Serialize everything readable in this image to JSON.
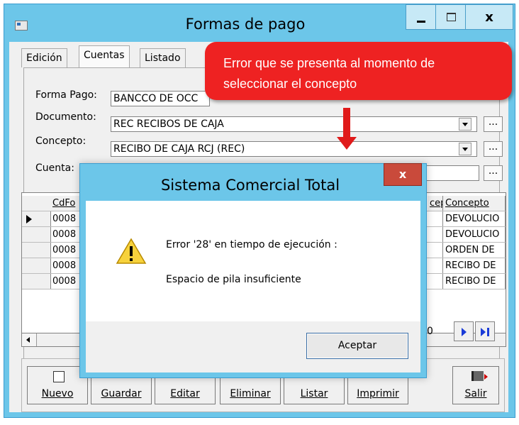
{
  "window": {
    "title": "Formas de pago",
    "close_label": "x"
  },
  "tabs": [
    {
      "label": "Edición"
    },
    {
      "label": "Cuentas"
    },
    {
      "label": "Listado"
    }
  ],
  "form": {
    "forma_pago_label": "Forma Pago:",
    "forma_pago_value": "BANCCO DE OCC",
    "documento_label": "Documento:",
    "documento_value": "REC  RECIBOS DE CAJA",
    "concepto_label": "Concepto:",
    "concepto_value": "RECIBO DE CAJA RCJ  (REC)",
    "cuenta_label": "Cuenta:",
    "ellipsis": "..."
  },
  "grid": {
    "headers": {
      "cdfo": "CdFo",
      "cep": "cep",
      "concepto": "Concepto"
    },
    "rows": [
      {
        "cdfo": "0008",
        "concepto": "DEVOLUCIO"
      },
      {
        "cdfo": "0008",
        "concepto": "DEVOLUCIO"
      },
      {
        "cdfo": "0008",
        "concepto": "ORDEN DE"
      },
      {
        "cdfo": "0008",
        "concepto": "RECIBO DE"
      },
      {
        "cdfo": "0008",
        "concepto": "RECIBO DE"
      }
    ],
    "page_fragment": "0"
  },
  "toolbar": {
    "nuevo": "Nuevo",
    "guardar": "Guardar",
    "editar": "Editar",
    "eliminar": "Eliminar",
    "listar": "Listar",
    "imprimir": "Imprimir",
    "salir": "Salir"
  },
  "callout": {
    "line1": "Error que se presenta al momento de",
    "line2": "seleccionar el concepto",
    "color": "#ee2222"
  },
  "dialog": {
    "title": "Sistema Comercial Total",
    "close_label": "x",
    "message": "Error '28' en tiempo de ejecución :",
    "detail": "Espacio de pila insuficiente",
    "ok_label": "Aceptar",
    "icon": "warning-icon"
  }
}
